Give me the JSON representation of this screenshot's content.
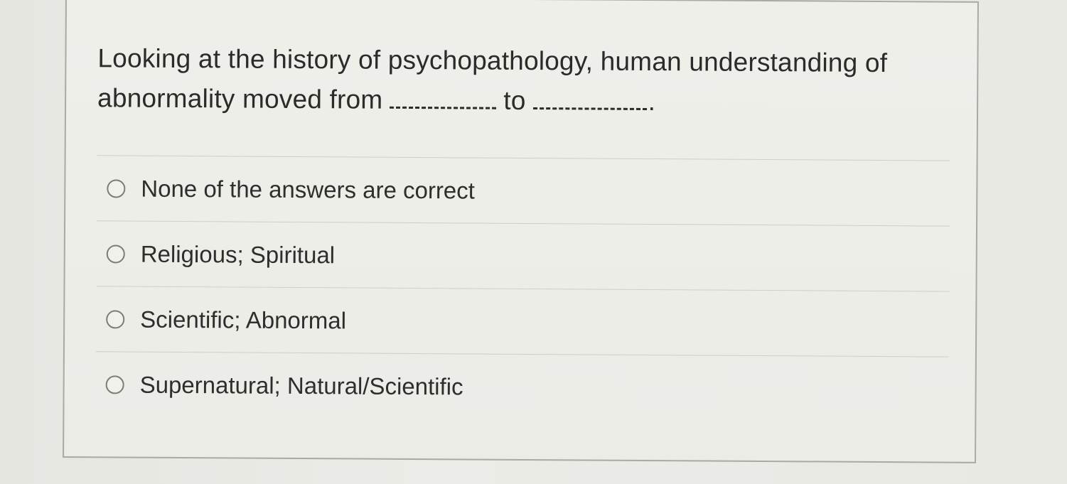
{
  "question": {
    "part1": "Looking at the history of psychopathology, human understanding of abnormality moved from",
    "connector": "to",
    "end": "."
  },
  "options": [
    {
      "label": "None of the answers are correct",
      "selected": false
    },
    {
      "label": "Religious; Spiritual",
      "selected": false
    },
    {
      "label": "Scientific; Abnormal",
      "selected": false
    },
    {
      "label": "Supernatural; Natural/Scientific",
      "selected": false
    }
  ]
}
